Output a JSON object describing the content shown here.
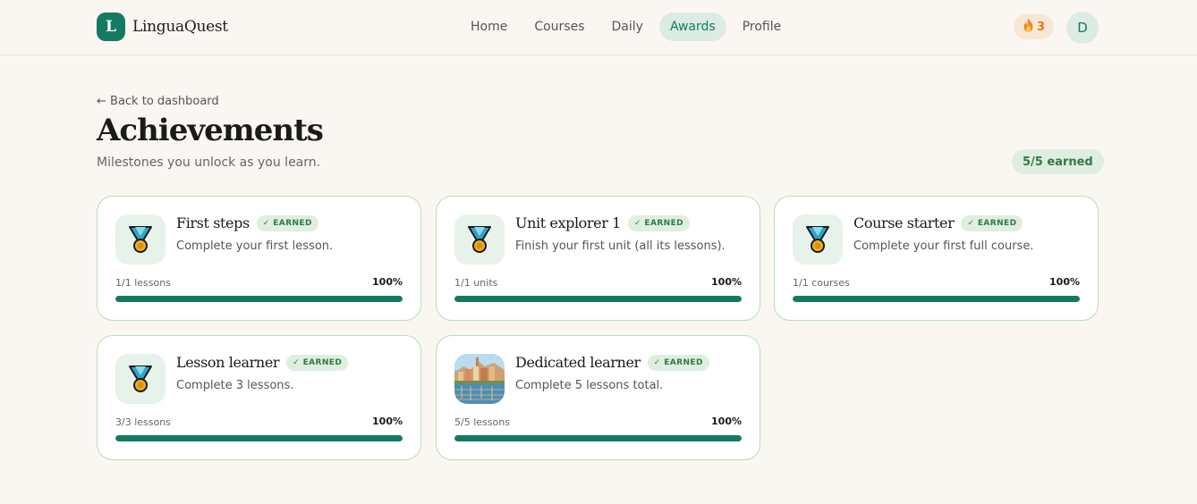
{
  "app": {
    "logo_letter": "L",
    "name": "LinguaQuest"
  },
  "nav": {
    "items": [
      {
        "label": "Home",
        "active": false
      },
      {
        "label": "Courses",
        "active": false
      },
      {
        "label": "Daily",
        "active": false
      },
      {
        "label": "Awards",
        "active": true
      },
      {
        "label": "Profile",
        "active": false
      }
    ]
  },
  "streak": {
    "icon": "fire-icon",
    "count": "3"
  },
  "user": {
    "avatar_initial": "D"
  },
  "page": {
    "back_link": "← Back to dashboard",
    "title": "Achievements",
    "subtitle": "Milestones you unlock as you learn.",
    "earned_summary": "5/5 earned"
  },
  "colors": {
    "accent": "#157a63",
    "badge_bg": "#dfeee0",
    "badge_text": "#2f7a45",
    "card_border": "#b9ddb8"
  },
  "achievements": [
    {
      "name": "First steps",
      "badge": "✓ EARNED",
      "description": "Complete your first lesson.",
      "progress_label": "1/1 lessons",
      "percent_label": "100%",
      "progress": 1.0,
      "icon": "medal-icon"
    },
    {
      "name": "Unit explorer 1",
      "badge": "✓ EARNED",
      "description": "Finish your first unit (all its lessons).",
      "progress_label": "1/1 units",
      "percent_label": "100%",
      "progress": 1.0,
      "icon": "medal-icon"
    },
    {
      "name": "Course starter",
      "badge": "✓ EARNED",
      "description": "Complete your first full course.",
      "progress_label": "1/1 courses",
      "percent_label": "100%",
      "progress": 1.0,
      "icon": "medal-icon"
    },
    {
      "name": "Lesson learner",
      "badge": "✓ EARNED",
      "description": "Complete 3 lessons.",
      "progress_label": "3/3 lessons",
      "percent_label": "100%",
      "progress": 1.0,
      "icon": "medal-icon"
    },
    {
      "name": "Dedicated learner",
      "badge": "✓ EARNED",
      "description": "Complete 5 lessons total.",
      "progress_label": "5/5 lessons",
      "percent_label": "100%",
      "progress": 1.0,
      "icon": "town-photo-icon"
    }
  ]
}
